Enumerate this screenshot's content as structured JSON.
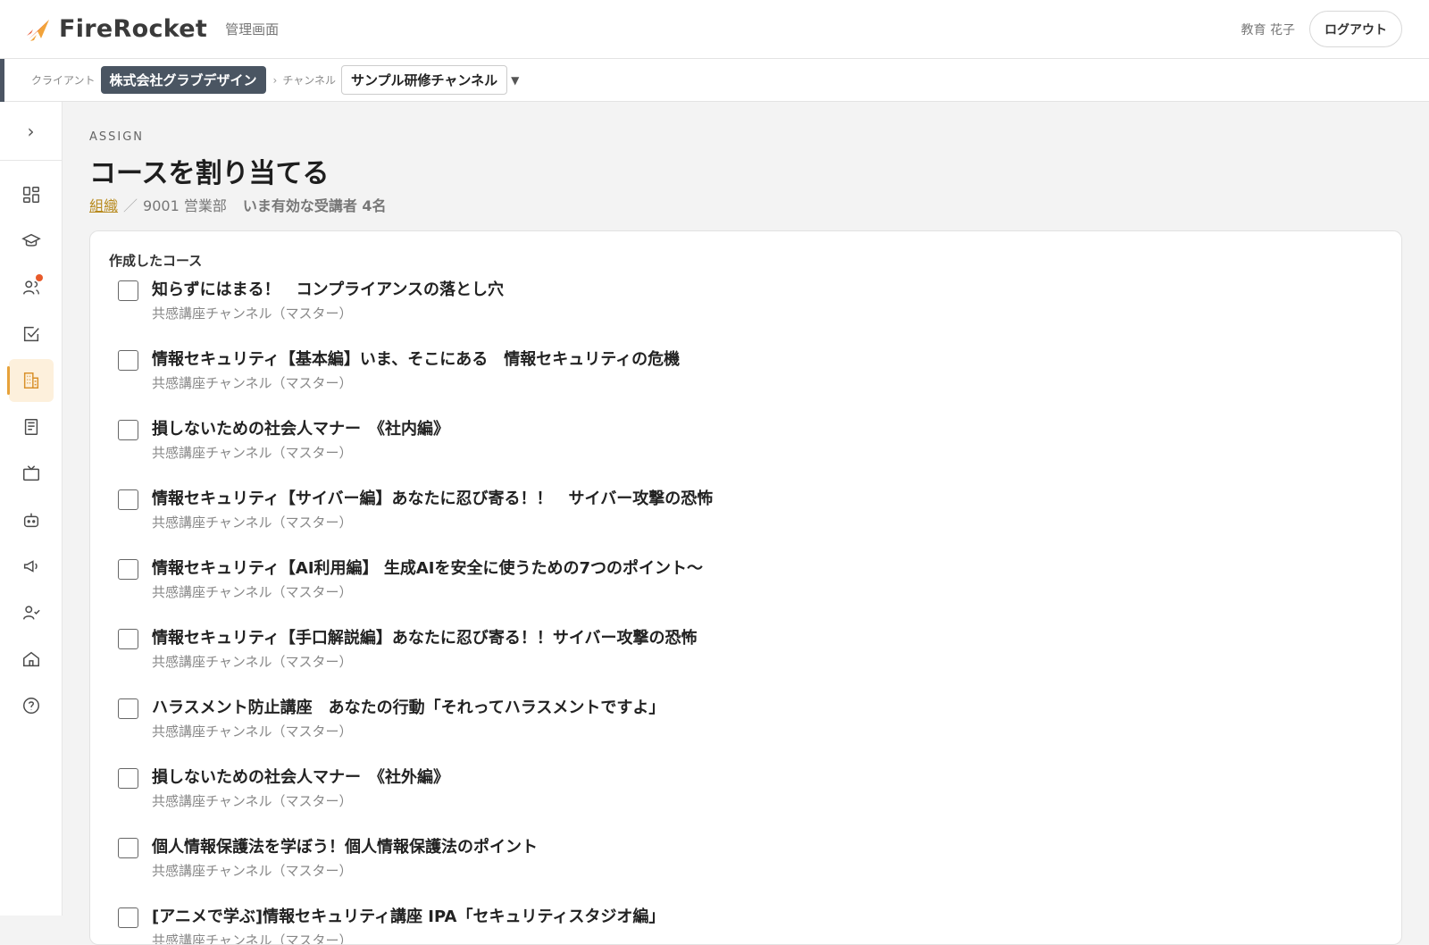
{
  "app": {
    "brand": "FireRocket",
    "admin_label": "管理画面",
    "user_name": "教育 花子",
    "logout_label": "ログアウト"
  },
  "context": {
    "client_label": "クライアント",
    "client_name": "株式会社グラブデザイン",
    "separator": "›",
    "channel_label": "チャンネル",
    "channel_name": "サンプル研修チャンネル"
  },
  "sidebar": {
    "items": [
      {
        "name": "dashboard",
        "icon": "grid-icon"
      },
      {
        "name": "courses",
        "icon": "graduation-cap-icon"
      },
      {
        "name": "users",
        "icon": "users-icon",
        "badge": true
      },
      {
        "name": "tasks",
        "icon": "checkbox-icon"
      },
      {
        "name": "organizations",
        "icon": "building-icon",
        "active": true
      },
      {
        "name": "documents",
        "icon": "book-icon"
      },
      {
        "name": "videos",
        "icon": "tv-icon"
      },
      {
        "name": "bot",
        "icon": "robot-icon"
      },
      {
        "name": "announcements",
        "icon": "megaphone-icon"
      },
      {
        "name": "user-approval",
        "icon": "user-check-icon"
      },
      {
        "name": "home",
        "icon": "home-icon"
      },
      {
        "name": "help",
        "icon": "help-icon"
      }
    ]
  },
  "page": {
    "eyebrow": "ASSIGN",
    "title": "コースを割り当てる",
    "org_link": "組織",
    "slash": "／",
    "org_name": "9001 営業部",
    "active_learners": "いま有効な受講者 4名"
  },
  "panel": {
    "title": "作成したコース",
    "courses": [
      {
        "title": "知らずにはまる！　コンプライアンスの落とし穴",
        "channel": "共感講座チャンネル（マスター）"
      },
      {
        "title": "情報セキュリティ【基本編】いま、そこにある　情報セキュリティの危機",
        "channel": "共感講座チャンネル（マスター）"
      },
      {
        "title": "損しないための社会人マナー　《社内編》",
        "channel": "共感講座チャンネル（マスター）"
      },
      {
        "title": "情報セキュリティ【サイバー編】あなたに忍び寄る！！　サイバー攻撃の恐怖",
        "channel": "共感講座チャンネル（マスター）"
      },
      {
        "title": "情報セキュリティ【AI利用編】 生成AIを安全に使うための7つのポイント〜",
        "channel": "共感講座チャンネル（マスター）"
      },
      {
        "title": "情報セキュリティ【手口解説編】あなたに忍び寄る！！サイバー攻撃の恐怖",
        "channel": "共感講座チャンネル（マスター）"
      },
      {
        "title": "ハラスメント防止講座　あなたの行動「それってハラスメントですよ」",
        "channel": "共感講座チャンネル（マスター）"
      },
      {
        "title": "損しないための社会人マナー　《社外編》",
        "channel": "共感講座チャンネル（マスター）"
      },
      {
        "title": "個人情報保護法を学ぼう！個人情報保護法のポイント",
        "channel": "共感講座チャンネル（マスター）"
      },
      {
        "title": "[アニメで学ぶ]情報セキュリティ講座 IPA「セキュリティスタジオ編」",
        "channel": "共感講座チャンネル（マスター）"
      }
    ]
  },
  "colors": {
    "accent": "#e7a23a",
    "client_pill": "#4a5562",
    "notification_dot": "#e85a2a",
    "org_link": "#b88a1e"
  }
}
